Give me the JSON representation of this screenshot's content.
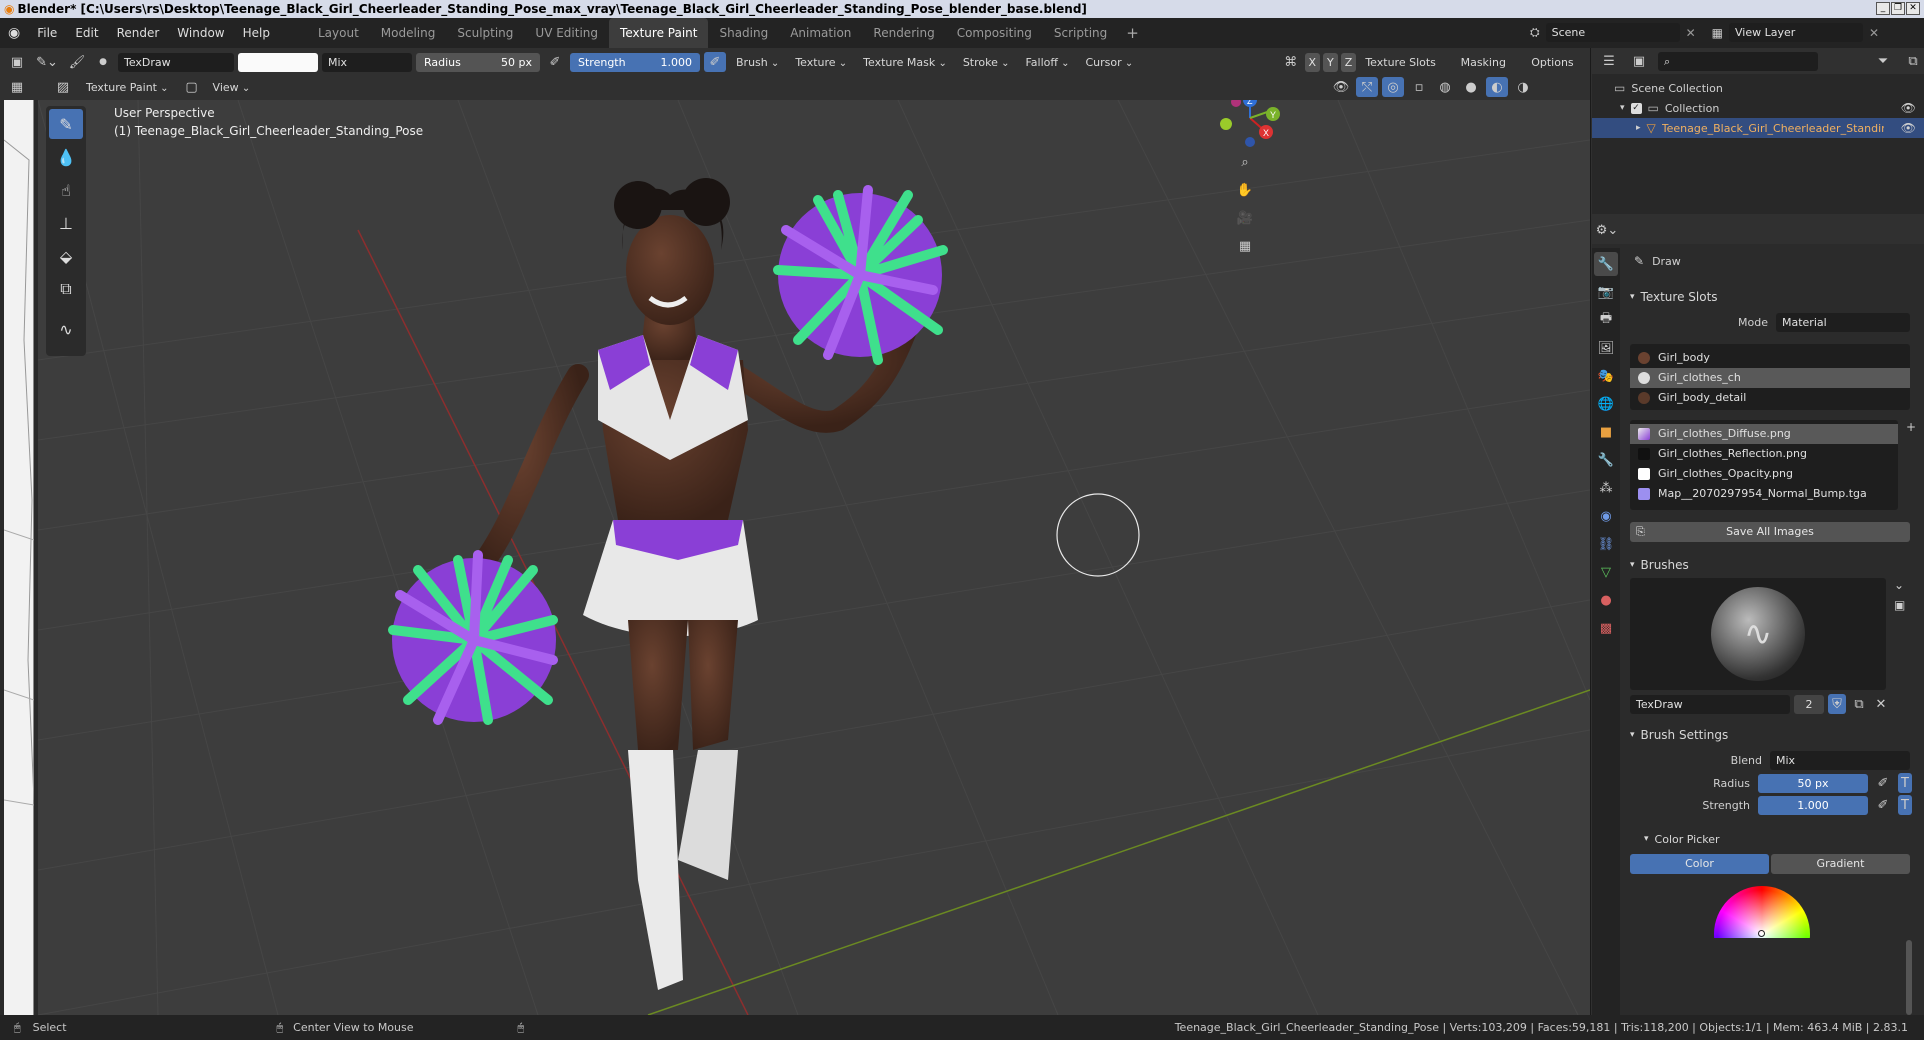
{
  "window": {
    "title": "Blender* [C:\\Users\\rs\\Desktop\\Teenage_Black_Girl_Cheerleader_Standing_Pose_max_vray\\Teenage_Black_Girl_Cheerleader_Standing_Pose_blender_base.blend]"
  },
  "menu": [
    "File",
    "Edit",
    "Render",
    "Window",
    "Help"
  ],
  "workspaces": [
    "Layout",
    "Modeling",
    "Sculpting",
    "UV Editing",
    "Texture Paint",
    "Shading",
    "Animation",
    "Rendering",
    "Compositing",
    "Scripting"
  ],
  "active_workspace": "Texture Paint",
  "scene": {
    "name": "Scene",
    "view_layer": "View Layer"
  },
  "toolbar": {
    "brush_name": "TexDraw",
    "blend": "Mix",
    "radius_label": "Radius",
    "radius_value": "50 px",
    "strength_label": "Strength",
    "strength_value": "1.000",
    "dropdowns": [
      "Brush",
      "Texture",
      "Texture Mask",
      "Stroke",
      "Falloff",
      "Cursor"
    ],
    "axes": [
      "X",
      "Y",
      "Z"
    ],
    "right_dropdowns": [
      "Texture Slots",
      "Masking",
      "Options"
    ]
  },
  "toolbar2": {
    "mode": "Texture Paint",
    "view": "View"
  },
  "viewport": {
    "perspective": "User Perspective",
    "object_label": "(1) Teenage_Black_Girl_Cheerleader_Standing_Pose",
    "gizmo": {
      "x": "X",
      "y": "Y",
      "z": "Z"
    }
  },
  "outliner": {
    "root": "Scene Collection",
    "collection": "Collection",
    "object": "Teenage_Black_Girl_Cheerleader_Standing_P"
  },
  "properties": {
    "tool_name": "Draw",
    "texture_slots_header": "Texture Slots",
    "mode_label": "Mode",
    "mode_value": "Material",
    "materials": [
      "Girl_body",
      "Girl_clothes_ch",
      "Girl_body_detail"
    ],
    "selected_material": "Girl_clothes_ch",
    "images": [
      "Girl_clothes_Diffuse.png",
      "Girl_clothes_Reflection.png",
      "Girl_clothes_Opacity.png",
      "Map__2070297954_Normal_Bump.tga"
    ],
    "selected_image": "Girl_clothes_Diffuse.png",
    "save_all": "Save All Images",
    "brushes_header": "Brushes",
    "brush_name": "TexDraw",
    "brush_users": "2",
    "brush_settings_header": "Brush Settings",
    "blend_label": "Blend",
    "blend_value": "Mix",
    "radius_label": "Radius",
    "radius_value": "50 px",
    "strength_label": "Strength",
    "strength_value": "1.000",
    "color_picker_header": "Color Picker",
    "color_tab": "Color",
    "gradient_tab": "Gradient"
  },
  "statusbar": {
    "select": "Select",
    "center": "Center View to Mouse",
    "info": "Teenage_Black_Girl_Cheerleader_Standing_Pose | Verts:103,209 | Faces:59,181 | Tris:118,200 | Objects:1/1 | Mem: 463.4 MiB | 2.83.1"
  },
  "colors": {
    "accent": "#4772b3",
    "viewport_bg": "#3d3d3d",
    "pom_green": "#3fe08c",
    "pom_purple": "#8a3fd6"
  }
}
